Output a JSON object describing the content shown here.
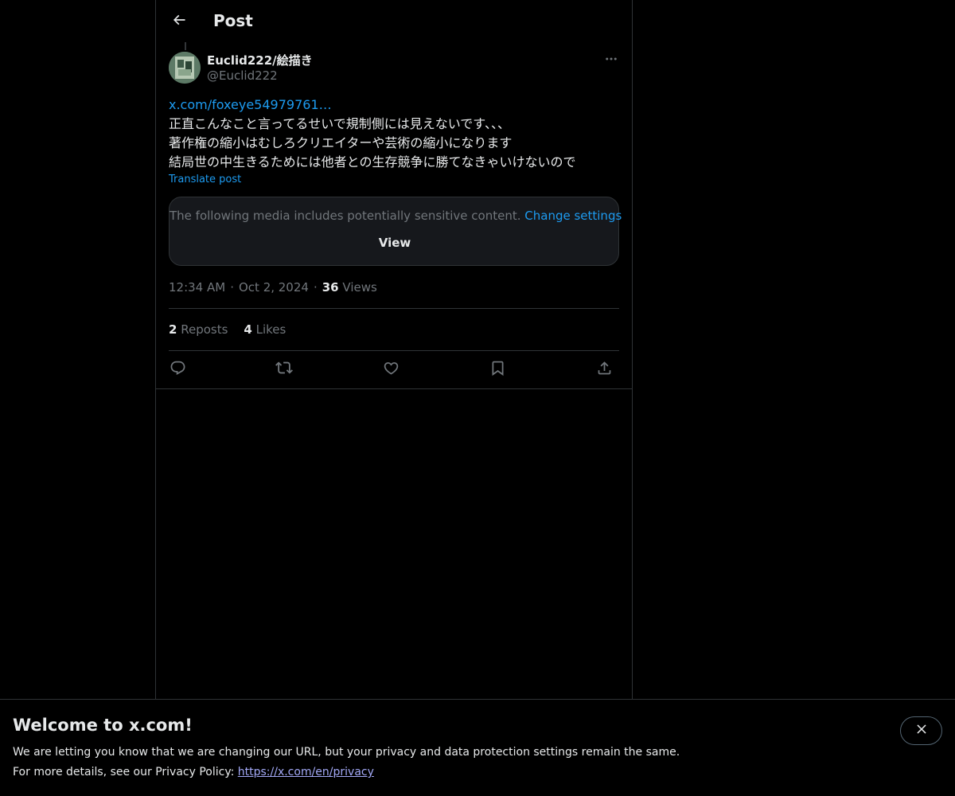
{
  "header": {
    "title": "Post"
  },
  "author": {
    "name": "Euclid222/絵描き",
    "handle": "@Euclid222"
  },
  "post": {
    "link": "x.com/foxeye54979761…",
    "lines": [
      "正直こんなこと言ってるせいで規制側には見えないです、、、",
      "著作権の縮小はむしろクリエイターや芸術の縮小になります",
      "結局世の中生きるためには他者との生存競争に勝てなきゃいけないので"
    ],
    "translate_label": "Translate post"
  },
  "sensitive": {
    "message": "The following media includes potentially sensitive content.",
    "change_label": "Change settings",
    "view_label": "View"
  },
  "meta": {
    "time": "12:34 AM",
    "date": "Oct 2, 2024",
    "views_count": "36",
    "views_label": "Views"
  },
  "stats": {
    "reposts_count": "2",
    "reposts_label": "Reposts",
    "likes_count": "4",
    "likes_label": "Likes"
  },
  "actions": [
    "reply-icon",
    "repost-icon",
    "like-icon",
    "bookmark-icon",
    "share-icon"
  ],
  "banner": {
    "title": "Welcome to x.com!",
    "line1": "We are letting you know that we are changing our URL, but your privacy and data protection settings remain the same.",
    "line2_prefix": "For more details, see our Privacy Policy:",
    "line2_link": "https://x.com/en/privacy"
  },
  "colors": {
    "background": "#000000",
    "accent": "#1d9bf0",
    "text": "#e7e9ea",
    "muted": "#71767b",
    "border": "#2f3336"
  }
}
